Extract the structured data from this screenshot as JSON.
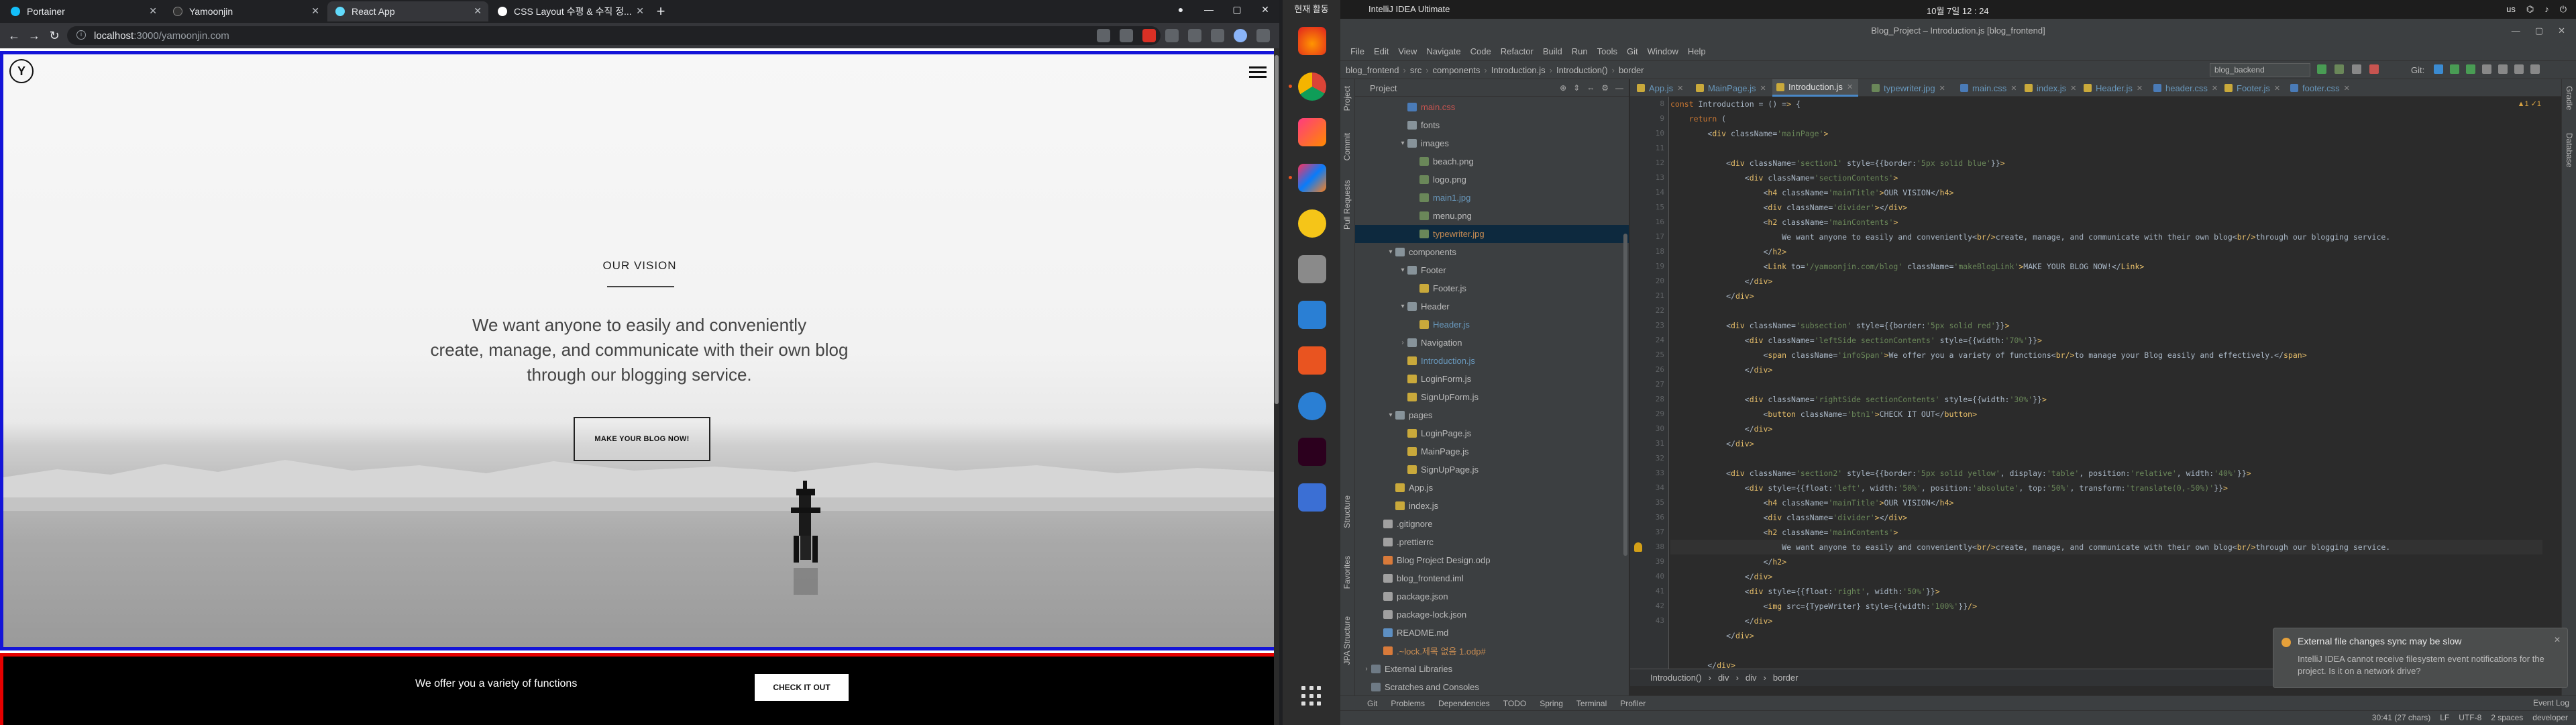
{
  "browser": {
    "tabs": [
      {
        "title": "Portainer",
        "active": false
      },
      {
        "title": "Yamoonjin",
        "active": false
      },
      {
        "title": "React App",
        "active": true
      },
      {
        "title": "CSS Layout 수평 & 수직 정...",
        "active": false
      }
    ],
    "url_host": "localhost",
    "url_path": ":3000/yamoonjin.com",
    "page": {
      "logo": "Y",
      "vision_title": "OUR VISION",
      "vision_text_line1": "We want anyone to easily and conveniently",
      "vision_text_line2": "create, manage, and communicate with their own blog",
      "vision_text_line3": "through our blogging service.",
      "blog_button": "MAKE YOUR BLOG NOW!",
      "section2_info": "We offer you a variety of functions",
      "section2_button": "CHECK IT OUT"
    },
    "colors": {
      "section1_border": "#1414d8",
      "section2_border": "#e60000"
    }
  },
  "dock": {
    "activities": "현재 활동",
    "apps": [
      "firefox-icon",
      "chrome-icon",
      "app-icon",
      "intellij-icon",
      "b-icon",
      "files-icon",
      "writer-icon",
      "software-icon",
      "help-icon",
      "terminal-icon",
      "screenshot-icon"
    ]
  },
  "ide": {
    "app_name": "IntelliJ IDEA Ultimate",
    "clock": "10월 7일  12 : 24",
    "sys_lang": "us",
    "window_title": "Blog_Project – Introduction.js [blog_frontend]",
    "menu": [
      "File",
      "Edit",
      "View",
      "Navigate",
      "Code",
      "Refactor",
      "Build",
      "Run",
      "Tools",
      "Git",
      "Window",
      "Help"
    ],
    "breadcrumbs": [
      "blog_frontend",
      "src",
      "components",
      "Introduction.js",
      "Introduction()",
      "border"
    ],
    "run_config": "blog_backend",
    "git_label": "Git:",
    "project_label": "Project",
    "tree": [
      {
        "indent": 3,
        "arrow": "",
        "icon": "css",
        "name": "main.css",
        "cls": "t-red"
      },
      {
        "indent": 3,
        "arrow": "",
        "icon": "folder",
        "name": "fonts",
        "cls": ""
      },
      {
        "indent": 3,
        "arrow": "▾",
        "icon": "folder",
        "name": "images",
        "cls": ""
      },
      {
        "indent": 4,
        "arrow": "",
        "icon": "png",
        "name": "beach.png",
        "cls": ""
      },
      {
        "indent": 4,
        "arrow": "",
        "icon": "png",
        "name": "logo.png",
        "cls": ""
      },
      {
        "indent": 4,
        "arrow": "",
        "icon": "jpg",
        "name": "main1.jpg",
        "cls": "t-blue"
      },
      {
        "indent": 4,
        "arrow": "",
        "icon": "png",
        "name": "menu.png",
        "cls": ""
      },
      {
        "indent": 4,
        "arrow": "",
        "icon": "jpg",
        "name": "typewriter.jpg",
        "cls": "t-brown",
        "selected": true
      },
      {
        "indent": 2,
        "arrow": "▾",
        "icon": "folder",
        "name": "components",
        "cls": ""
      },
      {
        "indent": 3,
        "arrow": "▾",
        "icon": "folder",
        "name": "Footer",
        "cls": ""
      },
      {
        "indent": 4,
        "arrow": "",
        "icon": "js",
        "name": "Footer.js",
        "cls": ""
      },
      {
        "indent": 3,
        "arrow": "▾",
        "icon": "folder",
        "name": "Header",
        "cls": ""
      },
      {
        "indent": 4,
        "arrow": "",
        "icon": "js",
        "name": "Header.js",
        "cls": "t-blue"
      },
      {
        "indent": 3,
        "arrow": "›",
        "icon": "folder",
        "name": "Navigation",
        "cls": ""
      },
      {
        "indent": 3,
        "arrow": "",
        "icon": "js",
        "name": "Introduction.js",
        "cls": "t-blue"
      },
      {
        "indent": 3,
        "arrow": "",
        "icon": "js",
        "name": "LoginForm.js",
        "cls": ""
      },
      {
        "indent": 3,
        "arrow": "",
        "icon": "js",
        "name": "SignUpForm.js",
        "cls": ""
      },
      {
        "indent": 2,
        "arrow": "▾",
        "icon": "folder",
        "name": "pages",
        "cls": ""
      },
      {
        "indent": 3,
        "arrow": "",
        "icon": "js",
        "name": "LoginPage.js",
        "cls": ""
      },
      {
        "indent": 3,
        "arrow": "",
        "icon": "js",
        "name": "MainPage.js",
        "cls": ""
      },
      {
        "indent": 3,
        "arrow": "",
        "icon": "js",
        "name": "SignUpPage.js",
        "cls": ""
      },
      {
        "indent": 2,
        "arrow": "",
        "icon": "js",
        "name": "App.js",
        "cls": ""
      },
      {
        "indent": 2,
        "arrow": "",
        "icon": "js",
        "name": "index.js",
        "cls": ""
      },
      {
        "indent": 1,
        "arrow": "",
        "icon": "json",
        "name": ".gitignore",
        "cls": ""
      },
      {
        "indent": 1,
        "arrow": "",
        "icon": "json",
        "name": ".prettierrc",
        "cls": ""
      },
      {
        "indent": 1,
        "arrow": "",
        "icon": "odp",
        "name": "Blog Project Design.odp",
        "cls": ""
      },
      {
        "indent": 1,
        "arrow": "",
        "icon": "json",
        "name": "blog_frontend.iml",
        "cls": ""
      },
      {
        "indent": 1,
        "arrow": "",
        "icon": "json",
        "name": "package.json",
        "cls": ""
      },
      {
        "indent": 1,
        "arrow": "",
        "icon": "json",
        "name": "package-lock.json",
        "cls": ""
      },
      {
        "indent": 1,
        "arrow": "",
        "icon": "md",
        "name": "README.md",
        "cls": ""
      },
      {
        "indent": 1,
        "arrow": "",
        "icon": "odp",
        "name": ".~lock.제목 없음 1.odp#",
        "cls": "t-brown"
      },
      {
        "indent": 0,
        "arrow": "›",
        "icon": "lib",
        "name": "External Libraries",
        "cls": ""
      },
      {
        "indent": 0,
        "arrow": "",
        "icon": "lib",
        "name": "Scratches and Consoles",
        "cls": ""
      }
    ],
    "editor_tabs": [
      {
        "name": "App.js",
        "color": "#c9a93b",
        "active": false
      },
      {
        "name": "MainPage.js",
        "color": "#c9a93b",
        "active": false
      },
      {
        "name": "Introduction.js",
        "color": "#c9a93b",
        "active": true
      },
      {
        "name": "typewriter.jpg",
        "color": "#6a8759",
        "active": false
      },
      {
        "name": "main.css",
        "color": "#4a7bb7",
        "active": false
      },
      {
        "name": "index.js",
        "color": "#c9a93b",
        "active": false
      },
      {
        "name": "Header.js",
        "color": "#c9a93b",
        "active": false
      },
      {
        "name": "header.css",
        "color": "#4a7bb7",
        "active": false
      },
      {
        "name": "Footer.js",
        "color": "#c9a93b",
        "active": false
      },
      {
        "name": "footer.css",
        "color": "#4a7bb7",
        "active": false
      }
    ],
    "line_numbers": [
      "8",
      "9",
      "10",
      "11",
      "12",
      "13",
      "14",
      "15",
      "16",
      "17",
      "18",
      "19",
      "20",
      "21",
      "22",
      "23",
      "24",
      "25",
      "26",
      "27",
      "28",
      "29",
      "30",
      "31",
      "32",
      "33",
      "34",
      "35",
      "36",
      "37",
      "38",
      "39",
      "40",
      "41",
      "42",
      "43"
    ],
    "code_lines": [
      "const Introduction = () => {",
      "    return (",
      "        <div className='mainPage'>",
      "",
      "            <div className='section1' style={{border:'5px solid blue'}}>",
      "                <div className='sectionContents'>",
      "                    <h4 className='mainTitle'>OUR VISION</h4>",
      "                    <div className='divider'></div>",
      "                    <h2 className='mainContents'>",
      "                        We want anyone to easily and conveniently<br/>create, manage, and communicate with their own blog<br/>through our blogging service.",
      "                    </h2>",
      "                    <Link to='/yamoonjin.com/blog' className='makeBlogLink'>MAKE YOUR BLOG NOW!</Link>",
      "                </div>",
      "            </div>",
      "",
      "            <div className='subsection' style={{border:'5px solid red'}}>",
      "                <div className='leftSide sectionContents' style={{width:'70%'}}>",
      "                    <span className='infoSpan'>We offer you a variety of functions<br/>to manage your Blog easily and effectively.</span>",
      "                </div>",
      "",
      "                <div className='rightSide sectionContents' style={{width:'30%'}}>",
      "                    <button className='btn1'>CHECK IT OUT</button>",
      "                </div>",
      "            </div>",
      "",
      "            <div className='section2' style={{border:'5px solid yellow', display:'table', position:'relative', width:'40%'}}>",
      "                <div style={{float:'left', width:'50%', position:'absolute', top:'50%', transform:'translate(0,-50%)'}}>",
      "                    <h4 className='mainTitle'>OUR VISION</h4>",
      "                    <div className='divider'></div>",
      "                    <h2 className='mainContents'>",
      "                        We want anyone to easily and conveniently<br/>create, manage, and communicate with their own blog<br/>through our blogging service.",
      "                    </h2>",
      "                </div>",
      "                <div style={{float:'right', width:'50%'}}>",
      "                    <img src={TypeWriter} style={{width:'100%'}}/>",
      "                </div>",
      "            </div>",
      "",
      "        </div>",
      "    );",
      "};"
    ],
    "warnings": "▲1  ✓1",
    "footer_crumbs": [
      "Introduction()",
      "div",
      "div",
      "border"
    ],
    "notification": {
      "title": "External file changes sync may be slow",
      "body": "IntelliJ IDEA cannot receive filesystem event notifications for the project. Is it on a network drive?"
    },
    "bottom_tools": [
      "Git",
      "Problems",
      "Dependencies",
      "TODO",
      "Spring",
      "Terminal",
      "Profiler"
    ],
    "event_log": "Event Log",
    "status": [
      "30:41 (27 chars)",
      "LF",
      "UTF-8",
      "2 spaces",
      "developer"
    ],
    "side_left": [
      "Project",
      "Commit",
      "Pull Requests"
    ],
    "side_left_bottom": [
      "Structure",
      "Favorites",
      "JPA Structure"
    ],
    "side_right": [
      "Gradle",
      "Database"
    ]
  }
}
